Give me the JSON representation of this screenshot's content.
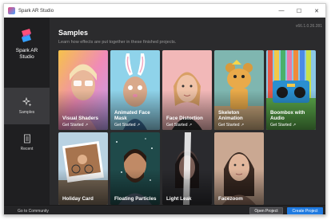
{
  "window": {
    "title": "Spark AR Studio"
  },
  "controls": {
    "minimize": "—",
    "maximize": "☐",
    "close": "✕"
  },
  "sidebar": {
    "logo_line1": "Spark AR",
    "logo_line2": "Studio",
    "items": [
      {
        "label": "Samples",
        "icon": "sparkles-icon",
        "active": true
      },
      {
        "label": "Recent",
        "icon": "document-icon",
        "active": false
      }
    ]
  },
  "main": {
    "heading": "Samples",
    "subheading": "Learn how effects are put together in these finished projects.",
    "version": "v66.1.0.26.281"
  },
  "cards": [
    {
      "title": "Visual Shaders",
      "cta": "Get Started ↗"
    },
    {
      "title": "Animated Face Mask",
      "cta": "Get Started ↗"
    },
    {
      "title": "Face Distortion",
      "cta": "Get Started ↗"
    },
    {
      "title": "Skeleton Animation",
      "cta": "Get Started ↗"
    },
    {
      "title": "Boombox with Audio",
      "cta": "Get Started ↗"
    },
    {
      "title": "Holiday Card"
    },
    {
      "title": "Floating Particles"
    },
    {
      "title": "Light Leak"
    },
    {
      "title": "Facezoom"
    }
  ],
  "footer": {
    "community": "Go to Community",
    "open_project": "Open Project",
    "create_project": "Create Project"
  },
  "colors": {
    "accent": "#1f7ae0",
    "sidebar_bg": "#1f1f21",
    "content_bg": "#2b2b2d"
  }
}
